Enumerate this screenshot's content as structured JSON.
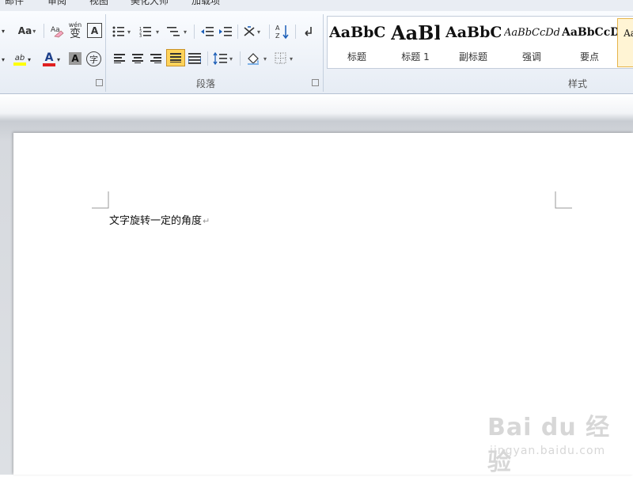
{
  "tabs": [
    "邮件",
    "审阅",
    "视图",
    "美化大师",
    "加载项"
  ],
  "font_group": {
    "change_case": "Aa",
    "phonetic_guide": "wén",
    "phonetic_char": "变",
    "char_border": "A",
    "font_color_letter": "A",
    "char_shading": "A",
    "enclose_char": "字",
    "highlight_label": "ab"
  },
  "paragraph_group": {
    "label": "段落"
  },
  "styles_group": {
    "label": "样式",
    "items": [
      {
        "sample": "AaBbC",
        "name": "标题"
      },
      {
        "sample": "AaBl",
        "name": "标题 1"
      },
      {
        "sample": "AaBbC",
        "name": "副标题"
      },
      {
        "sample": "AaBbCcDd",
        "name": "强调"
      },
      {
        "sample": "AaBbCcD",
        "name": "要点"
      },
      {
        "sample": "Aa",
        "name": ""
      }
    ]
  },
  "document": {
    "text": "文字旋转一定的角度",
    "paragraph_mark": "↵"
  },
  "watermark": {
    "brand": "Bai du 经验",
    "url": "jingyan.baidu.com"
  },
  "colors": {
    "font_color": "#e02020",
    "highlight": "#ffff00",
    "selected_button": "#ffd35a"
  }
}
